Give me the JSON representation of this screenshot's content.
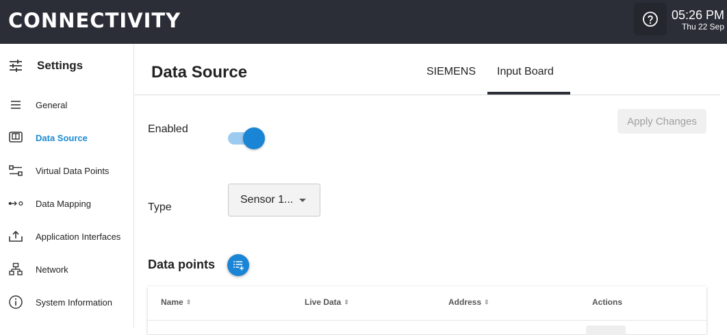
{
  "topbar": {
    "brand": "CONNECTIVITY",
    "time": "05:26 PM",
    "date": "Thu 22 Sep"
  },
  "sidebar": {
    "title": "Settings",
    "items": [
      {
        "label": "General",
        "icon": "menu-icon"
      },
      {
        "label": "Data Source",
        "icon": "data-source-icon",
        "active": true
      },
      {
        "label": "Virtual Data Points",
        "icon": "virtual-data-points-icon"
      },
      {
        "label": "Data Mapping",
        "icon": "data-mapping-icon"
      },
      {
        "label": "Application Interfaces",
        "icon": "upload-icon"
      },
      {
        "label": "Network",
        "icon": "network-icon"
      },
      {
        "label": "System Information",
        "icon": "info-icon"
      }
    ]
  },
  "main": {
    "title": "Data Source",
    "tabs": [
      {
        "label": "SIEMENS",
        "active": false
      },
      {
        "label": "Input Board",
        "active": true
      }
    ],
    "apply_label": "Apply Changes",
    "enabled_label": "Enabled",
    "enabled": true,
    "type_label": "Type",
    "type_value": "Sensor 1...",
    "datapoints_title": "Data points",
    "table": {
      "columns": [
        "Name",
        "Live Data",
        "Address",
        "Actions"
      ]
    }
  },
  "colors": {
    "topbar": "#2b2e37",
    "accent": "#1a85d4",
    "active_text": "#1a8ad4"
  }
}
